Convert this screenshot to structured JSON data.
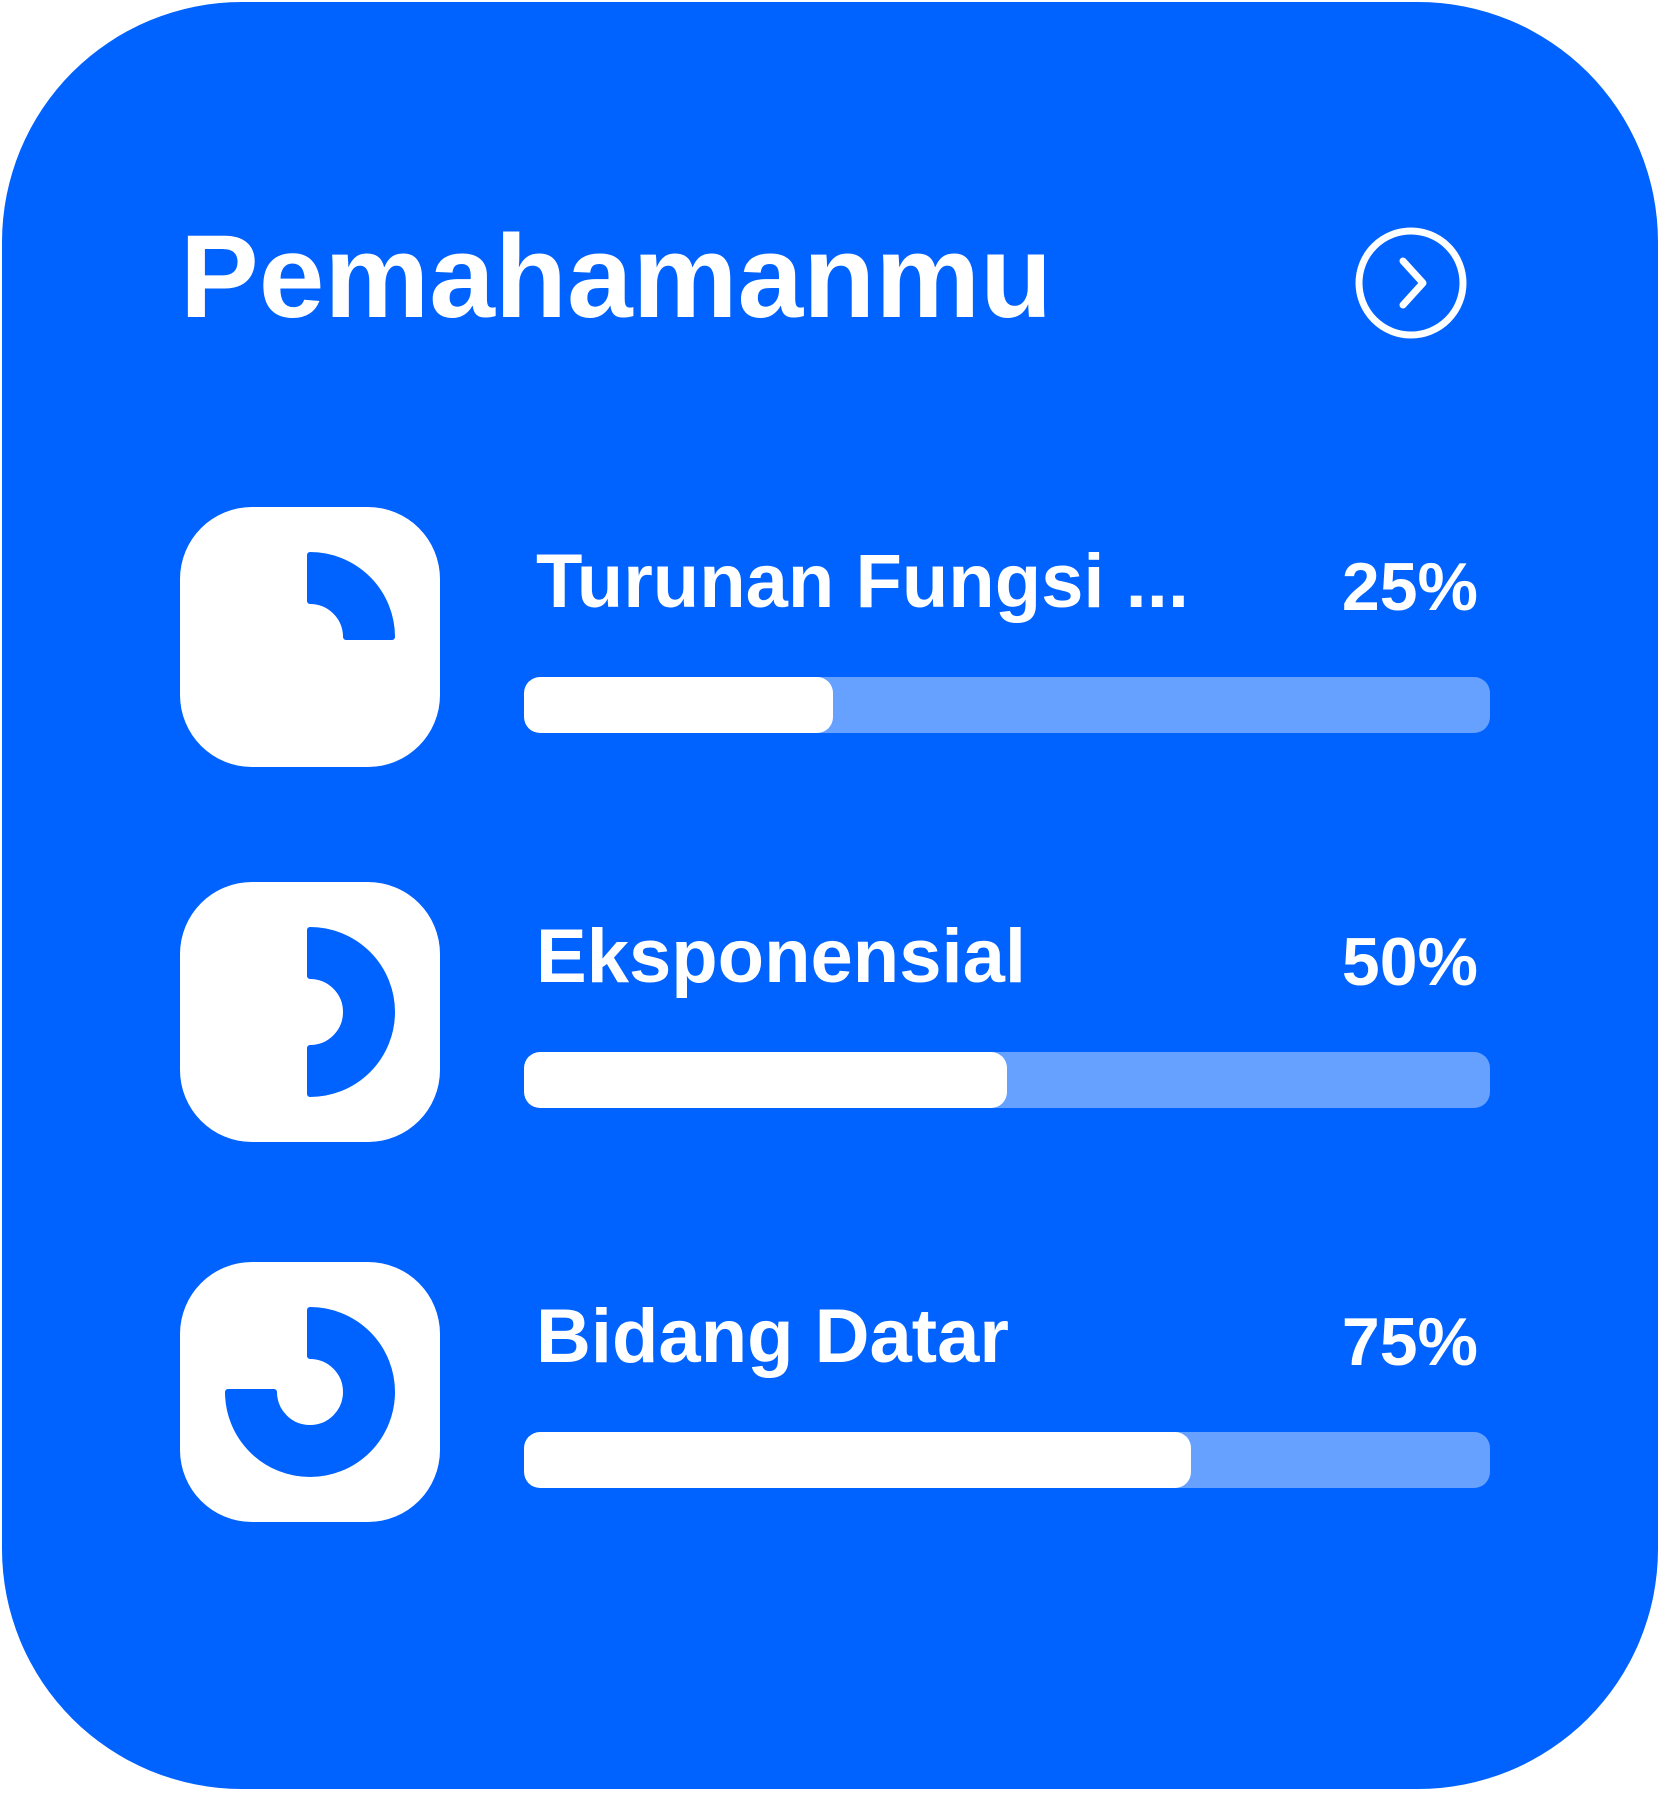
{
  "card": {
    "title": "Pemahamanmu",
    "background_color": "#0062ff",
    "track_color": "#66a1ff",
    "next_button_icon": "chevron-right-circle-icon"
  },
  "topics": [
    {
      "name": "Turunan Fungsi ...",
      "percent_label": "25%",
      "progress": 0.32,
      "icon": "quarter-pie-icon"
    },
    {
      "name": "Eksponensial",
      "percent_label": "50%",
      "progress": 0.5,
      "icon": "half-pie-icon"
    },
    {
      "name": "Bidang Datar",
      "percent_label": "75%",
      "progress": 0.69,
      "icon": "three-quarter-pie-icon"
    }
  ]
}
